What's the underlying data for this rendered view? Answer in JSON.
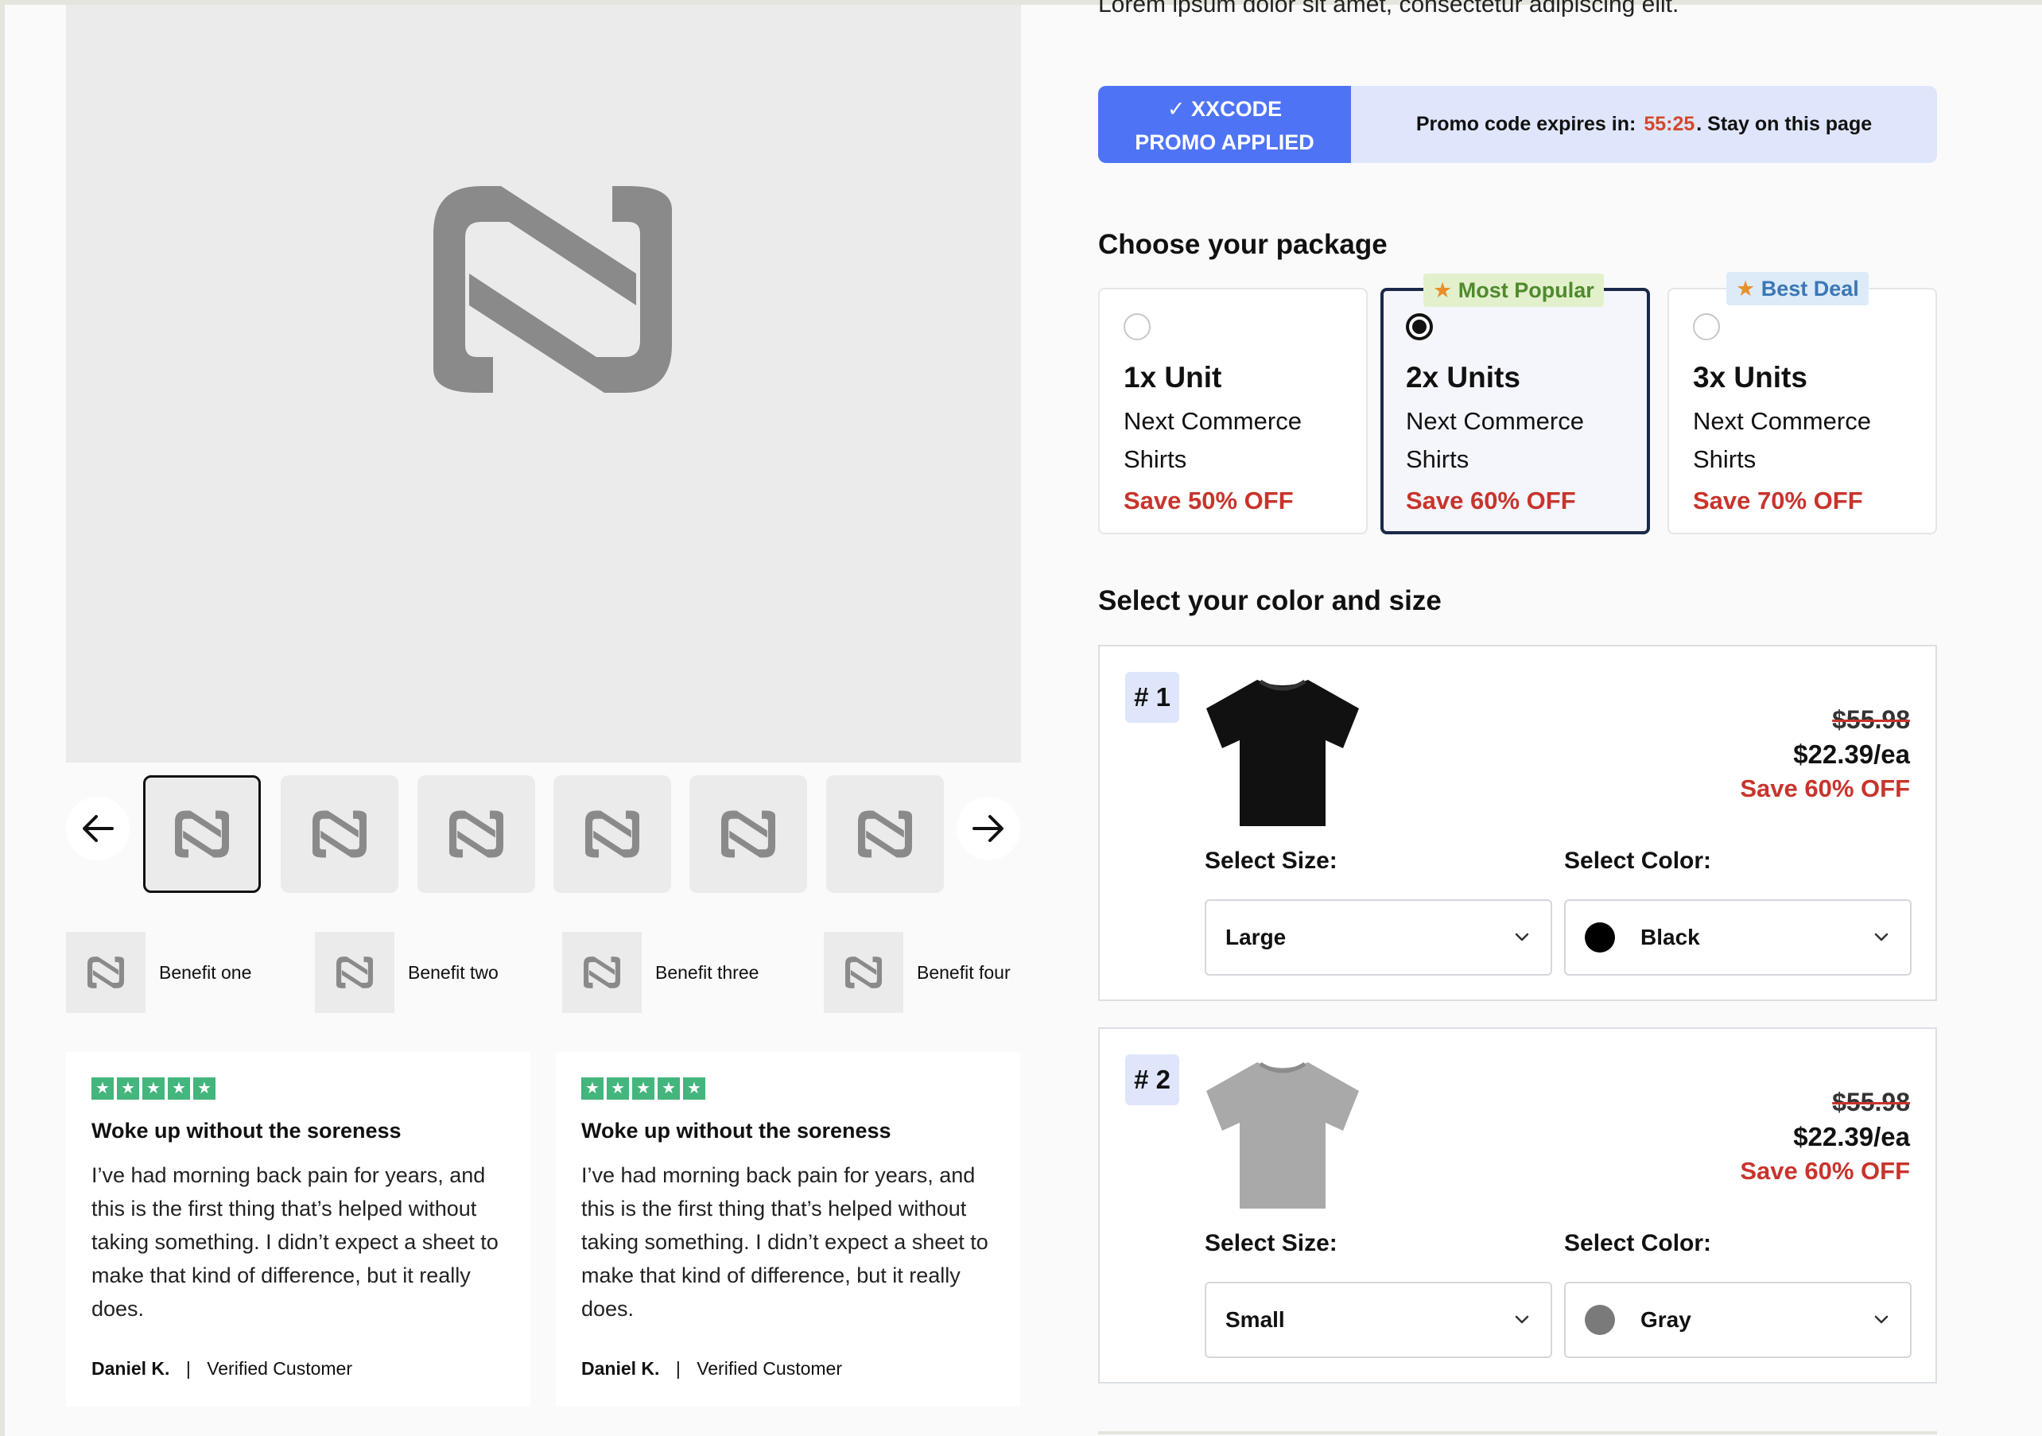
{
  "intro": {
    "text": "Lorem ipsum dolor sit amet, consectetur adipiscing elit."
  },
  "promo": {
    "badge_line1": "✓ XXCODE",
    "badge_line2": "PROMO APPLIED",
    "expires_label": "Promo code expires in:",
    "timer": "55:25",
    "suffix": ". Stay on this page",
    "badge_color": "#4e74f5",
    "timer_color": "#d2482b"
  },
  "gallery": {
    "thumb_count": 6,
    "icons": {
      "prev": "arrow-left-icon",
      "next": "arrow-right-icon",
      "brand": "brand-logo-icon"
    }
  },
  "benefits": [
    {
      "label": "Benefit one"
    },
    {
      "label": "Benefit two"
    },
    {
      "label": "Benefit three"
    },
    {
      "label": "Benefit four"
    }
  ],
  "reviews": [
    {
      "stars": 5,
      "title": "Woke up without the soreness",
      "body": "I’ve had morning back pain for years, and this is the first thing that’s helped without taking something. I didn’t expect a sheet to make that kind of difference, but it really does.",
      "author": "Daniel K.",
      "separator": "|",
      "badge": "Verified Customer"
    },
    {
      "stars": 5,
      "title": "Woke up without the soreness",
      "body": "I’ve had morning back pain for years, and this is the first thing that’s helped without taking something. I didn’t expect a sheet to make that kind of difference, but it really does.",
      "author": "Daniel K.",
      "separator": "|",
      "badge": "Verified Customer"
    }
  ],
  "packages": {
    "title": "Choose your package",
    "items": [
      {
        "name": "1x Unit",
        "desc": "Next Commerce Shirts",
        "save": "Save 50% OFF",
        "tag": "",
        "selected": false
      },
      {
        "name": "2x Units",
        "desc": "Next Commerce Shirts",
        "save": "Save 60% OFF",
        "tag": "Most Popular",
        "selected": true
      },
      {
        "name": "3x Units",
        "desc": "Next Commerce Shirts",
        "save": "Save 70% OFF",
        "tag": "Best Deal",
        "selected": false
      }
    ]
  },
  "variants": {
    "title": "Select your color and size",
    "size_label": "Select Size:",
    "color_label": "Select Color:",
    "items": [
      {
        "num": "# 1",
        "old_price": "$55.98",
        "price": "$22.39/ea",
        "save": "Save 60% OFF",
        "size": "Large",
        "color": "Black",
        "swatch": "#000000",
        "shirt_color": "#111111"
      },
      {
        "num": "# 2",
        "old_price": "$55.98",
        "price": "$22.39/ea",
        "save": "Save 60% OFF",
        "size": "Small",
        "color": "Gray",
        "swatch": "#7a7a7a",
        "shirt_color": "#a9a9a9"
      }
    ]
  }
}
